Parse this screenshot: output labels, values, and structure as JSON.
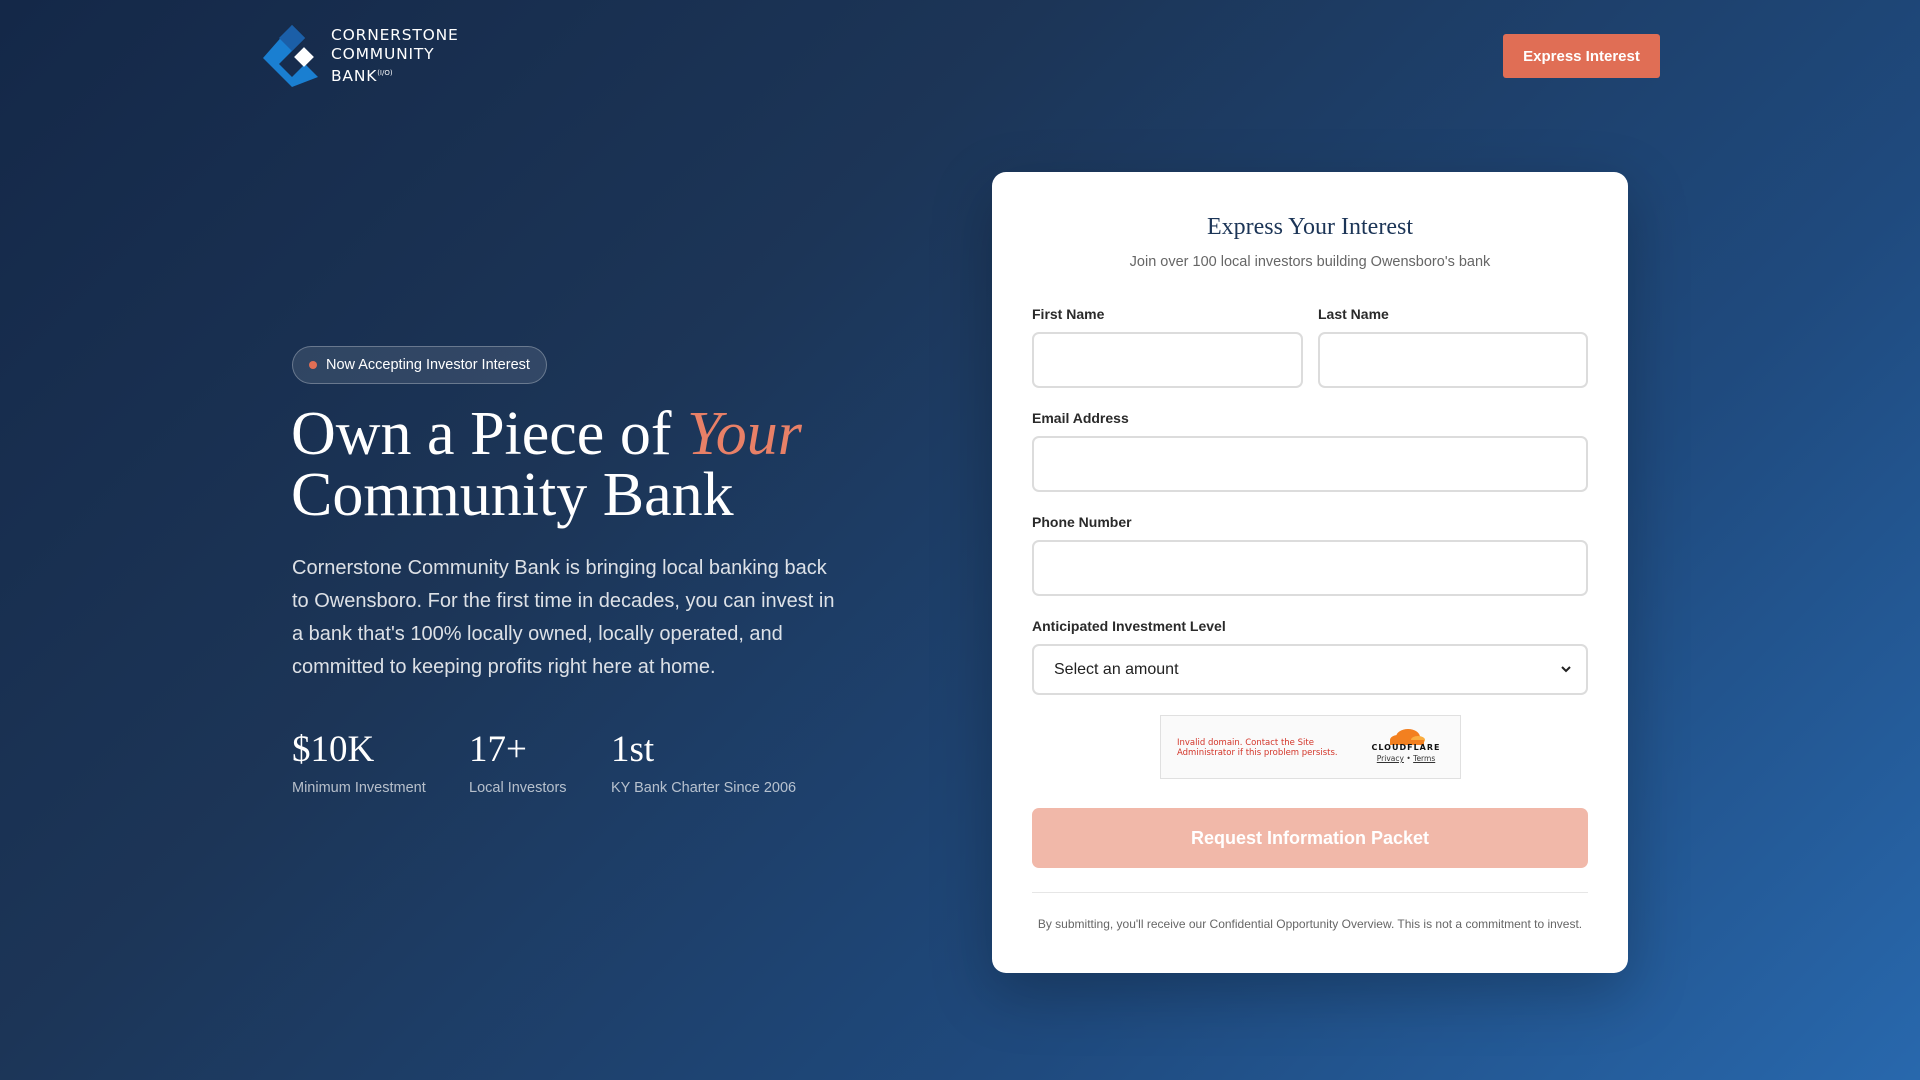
{
  "header": {
    "logo": {
      "line1": "CORNERSTONE",
      "line2": "COMMUNITY",
      "line3": "BANK",
      "line3_sup": "(I/O)",
      "colors": {
        "mark_primary": "#1a7fd1",
        "mark_dark": "#1b5fa8",
        "mark_inner": "#ffffff"
      }
    },
    "cta_label": "Express Interest"
  },
  "hero": {
    "badge_text": "Now Accepting Investor Interest",
    "headline_part1": "Own a Piece of ",
    "headline_emphasis": "Your",
    "headline_part2": "Community Bank",
    "lead": "Cornerstone Community Bank is bringing local banking back to Owensboro. For the first time in decades, you can invest in a bank that's 100% locally owned, locally operated, and committed to keeping profits right here at home.",
    "stats": [
      {
        "value": "$10K",
        "label": "Minimum Investment"
      },
      {
        "value": "17+",
        "label": "Local Investors"
      },
      {
        "value": "1st",
        "label": "KY Bank Charter Since 2006"
      }
    ]
  },
  "form": {
    "title": "Express Your Interest",
    "subtitle": "Join over 100 local investors building Owensboro's bank",
    "first_name_label": "First Name",
    "first_name_value": "",
    "last_name_label": "Last Name",
    "last_name_value": "",
    "email_label": "Email Address",
    "email_value": "",
    "phone_label": "Phone Number",
    "phone_value": "",
    "investment_label": "Anticipated Investment Level",
    "investment_selected": "Select an amount",
    "captcha": {
      "error": "Invalid domain. Contact the Site Administrator if this problem persists.",
      "brand": "CLOUDFLARE",
      "privacy": "Privacy",
      "separator": "•",
      "terms": "Terms"
    },
    "submit_label": "Request Information Packet",
    "disclaimer": "By submitting, you'll receive our Confidential Opportunity Overview. This is not a commitment to invest."
  },
  "colors": {
    "accent": "#e06e55",
    "accent_light": "#e88067",
    "submit_disabled": "#f1b8a9",
    "navy": "#1c3557"
  }
}
